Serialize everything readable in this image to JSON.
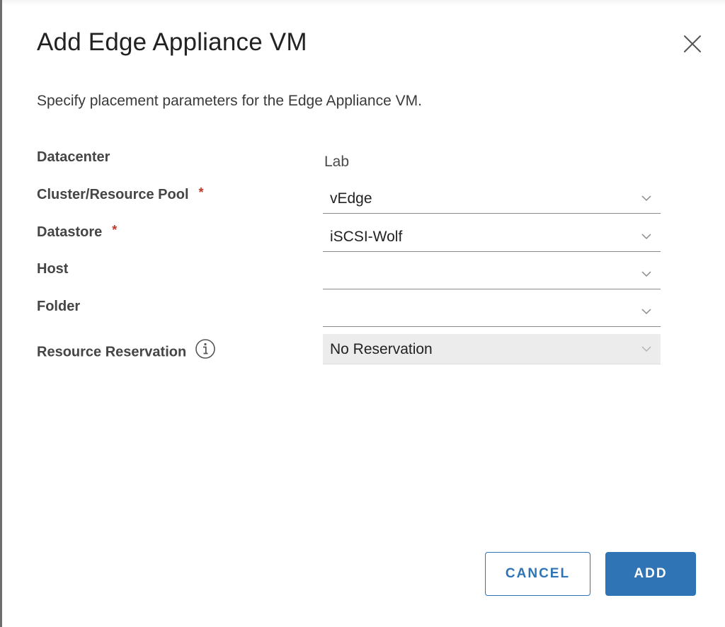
{
  "dialog": {
    "title": "Add Edge Appliance VM",
    "description": "Specify placement parameters for the Edge Appliance VM."
  },
  "form": {
    "datacenter": {
      "label": "Datacenter",
      "value": "Lab"
    },
    "cluster": {
      "label": "Cluster/Resource Pool",
      "required_mark": "*",
      "value": "vEdge"
    },
    "datastore": {
      "label": "Datastore",
      "required_mark": "*",
      "value": "iSCSI-Wolf"
    },
    "host": {
      "label": "Host",
      "value": ""
    },
    "folder": {
      "label": "Folder",
      "value": ""
    },
    "reservation": {
      "label": "Resource Reservation",
      "value": "No Reservation",
      "disabled": true
    }
  },
  "actions": {
    "cancel_label": "CANCEL",
    "add_label": "ADD"
  },
  "icons": {
    "close": "close-icon",
    "info": "info-icon",
    "dropdown": "chevron-down-icon"
  },
  "colors": {
    "primary": "#2f75b5",
    "required": "#c0392b",
    "disabled_field": "#ececec"
  }
}
